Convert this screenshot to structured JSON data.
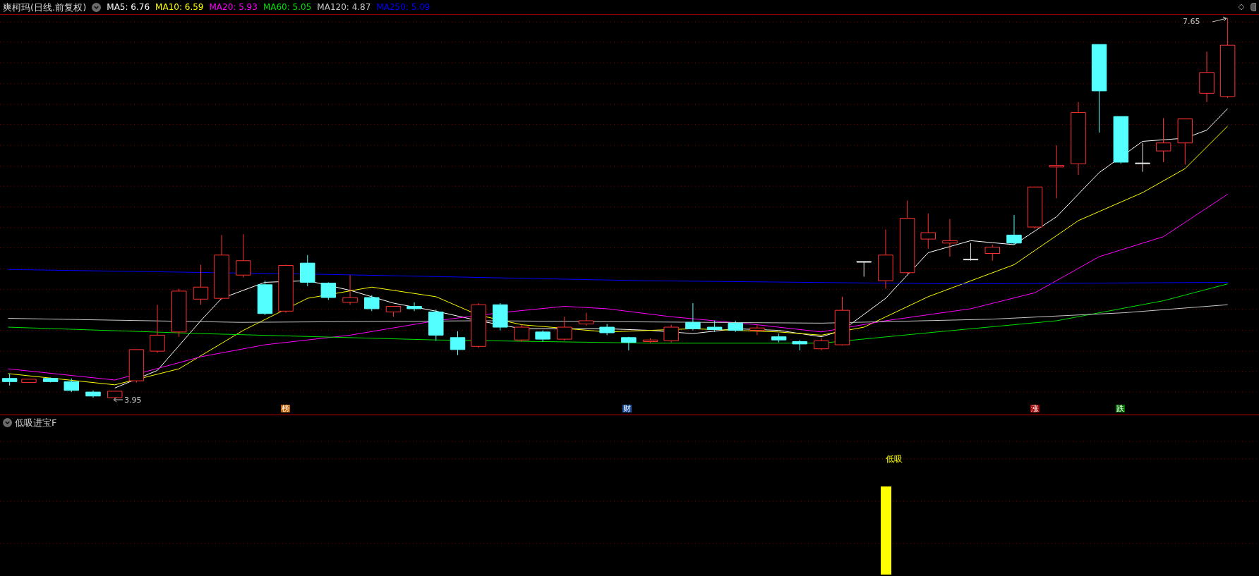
{
  "header": {
    "title": "爽柯玛(日线.前复权)",
    "ma": [
      {
        "label": "MA5: 6.76",
        "color": "#ffffff"
      },
      {
        "label": "MA10: 6.59",
        "color": "#ffff00"
      },
      {
        "label": "MA20: 5.93",
        "color": "#ff00ff"
      },
      {
        "label": "MA60: 5.05",
        "color": "#00e000"
      },
      {
        "label": "MA120: 4.87",
        "color": "#c8c8c8"
      },
      {
        "label": "MA250: 5.09",
        "color": "#0000ff"
      }
    ]
  },
  "main_chart": {
    "high_label": "7.65",
    "low_label": "3.95",
    "markers": [
      {
        "text": "榜",
        "color": "#c06000"
      },
      {
        "text": "财",
        "color": "#1a4fa0"
      },
      {
        "text": "涨",
        "color": "#a00000"
      },
      {
        "text": "跌",
        "color": "#007000"
      }
    ]
  },
  "indicator_panel": {
    "title": "低吸进宝F",
    "signal_label": "低吸"
  }
}
